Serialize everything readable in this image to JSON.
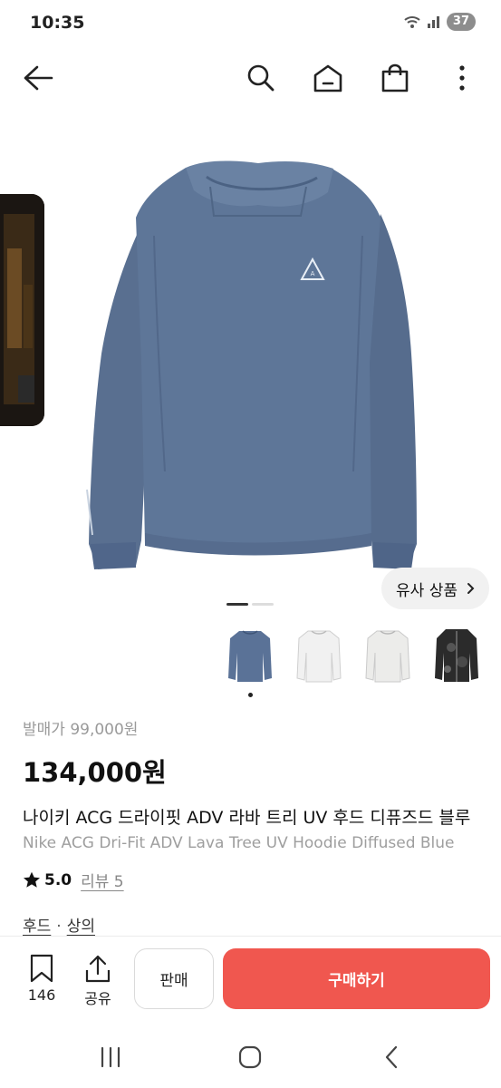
{
  "status_bar": {
    "time": "10:35",
    "battery": "37"
  },
  "nav": {
    "icons": [
      "back-arrow-icon",
      "search-icon",
      "home-icon",
      "shopping-bag-icon",
      "more-vertical-icon"
    ]
  },
  "gallery": {
    "similar_label": "유사 상품",
    "page_count": 2,
    "current_page": 1,
    "thumbnails": [
      "blue-hoodie",
      "white-hoodie",
      "white-hoodie-2",
      "black-camo-jacket"
    ],
    "selected_thumbnail": 0
  },
  "product": {
    "original_price": "발매가 99,000원",
    "price": "134,000원",
    "title_ko": "나이키 ACG 드라이핏 ADV 라바 트리 UV 후드 디퓨즈드 블루",
    "title_en": "Nike ACG Dri-Fit ADV Lava Tree UV Hoodie Diffused Blue",
    "rating": "5.0",
    "review_label": "리뷰 5",
    "categories": [
      "후드",
      "상의"
    ],
    "category_separator": "·"
  },
  "bottom_bar": {
    "bookmark_count": "146",
    "share_label": "공유",
    "sell_label": "판매",
    "buy_label": "구매하기"
  },
  "colors": {
    "accent": "#f0574f",
    "product_blue": "#5e7698"
  }
}
